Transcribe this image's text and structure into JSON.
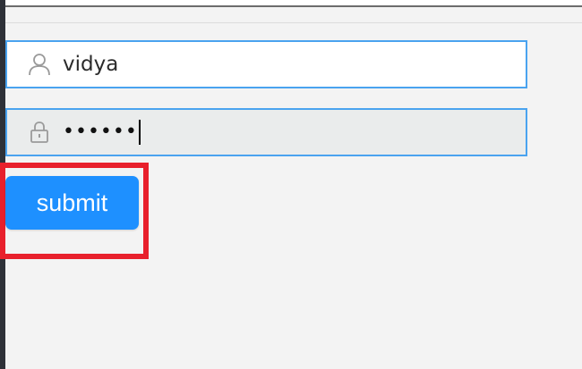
{
  "login_form": {
    "username": {
      "value": "vidya",
      "icon": "user-icon"
    },
    "password": {
      "masked_value": "••••••",
      "icon": "lock-icon"
    },
    "submit_label": "submit"
  },
  "colors": {
    "field_border": "#4aa3ef",
    "button_bg": "#1e90ff",
    "highlight": "#e8202c",
    "page_bg": "#f3f3f3"
  }
}
